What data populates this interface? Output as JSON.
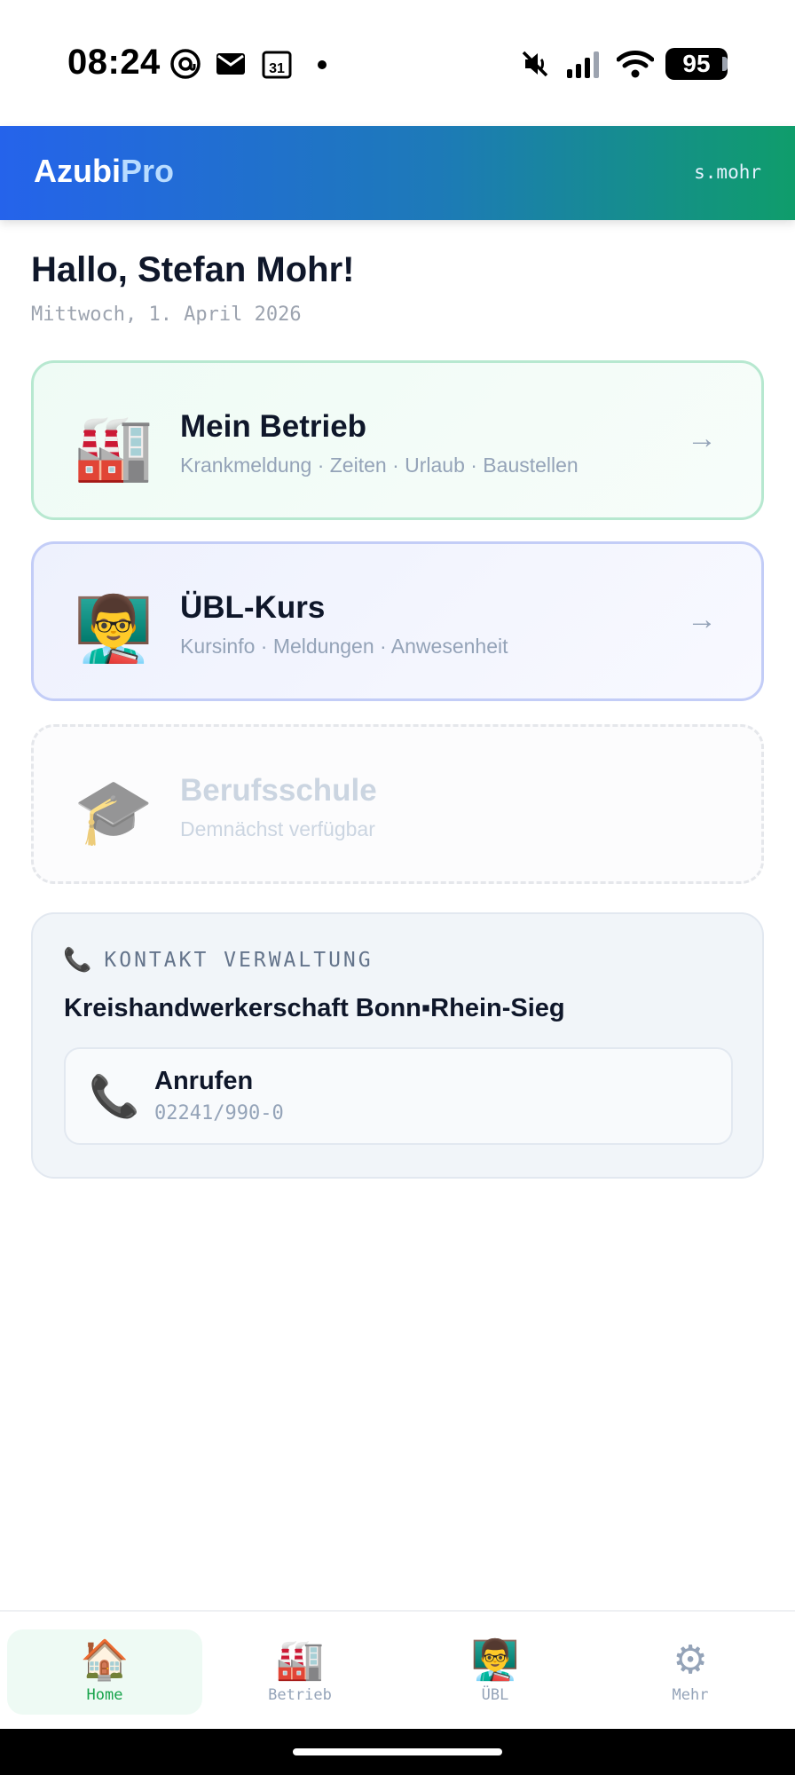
{
  "status_bar": {
    "time": "08:24",
    "battery": "95",
    "icons": [
      "at-notification-icon",
      "mail-icon",
      "calendar-31-icon",
      "dot-icon",
      "mute-icon",
      "signal-icon",
      "wifi-icon",
      "battery-icon"
    ],
    "calendar_day": "31"
  },
  "header": {
    "brand_part1": "Azubi",
    "brand_part2": "Pro",
    "username": "s.mohr",
    "gradient": [
      "#2563eb",
      "#0f9d6b"
    ]
  },
  "greeting": {
    "title": "Hallo, Stefan Mohr!",
    "date": "Mittwoch, 1. April 2026"
  },
  "cards": [
    {
      "icon": "🏭",
      "icon_name": "factory-icon",
      "title": "Mein Betrieb",
      "subtitle": "Krankmeldung · Zeiten · Urlaub · Baustellen",
      "arrow": "→"
    },
    {
      "icon": "👨‍🏫",
      "icon_name": "teacher-icon",
      "title": "ÜBL-Kurs",
      "subtitle": "Kursinfo · Meldungen · Anwesenheit",
      "arrow": "→"
    },
    {
      "icon": "🎓",
      "icon_name": "graduation-cap-icon",
      "title": "Berufsschule",
      "subtitle": "Demnächst verfügbar"
    }
  ],
  "contact": {
    "icon": "📞",
    "label": "KONTAKT VERWALTUNG",
    "organization": "Kreishandwerkerschaft Bonn▪Rhein-Sieg",
    "call_icon": "📞",
    "call_label": "Anrufen",
    "phone": "02241/990-0"
  },
  "bottom_nav": [
    {
      "icon": "🏠",
      "label": "Home",
      "active": true
    },
    {
      "icon": "🏭",
      "label": "Betrieb",
      "active": false
    },
    {
      "icon": "👨‍🏫",
      "label": "ÜBL",
      "active": false
    },
    {
      "icon": "⚙",
      "label": "Mehr",
      "active": false
    }
  ],
  "colors": {
    "accent_green": "#16a34a",
    "accent_blue": "#2563eb",
    "text_dark": "#0f172a",
    "text_muted": "#94a3b8"
  }
}
